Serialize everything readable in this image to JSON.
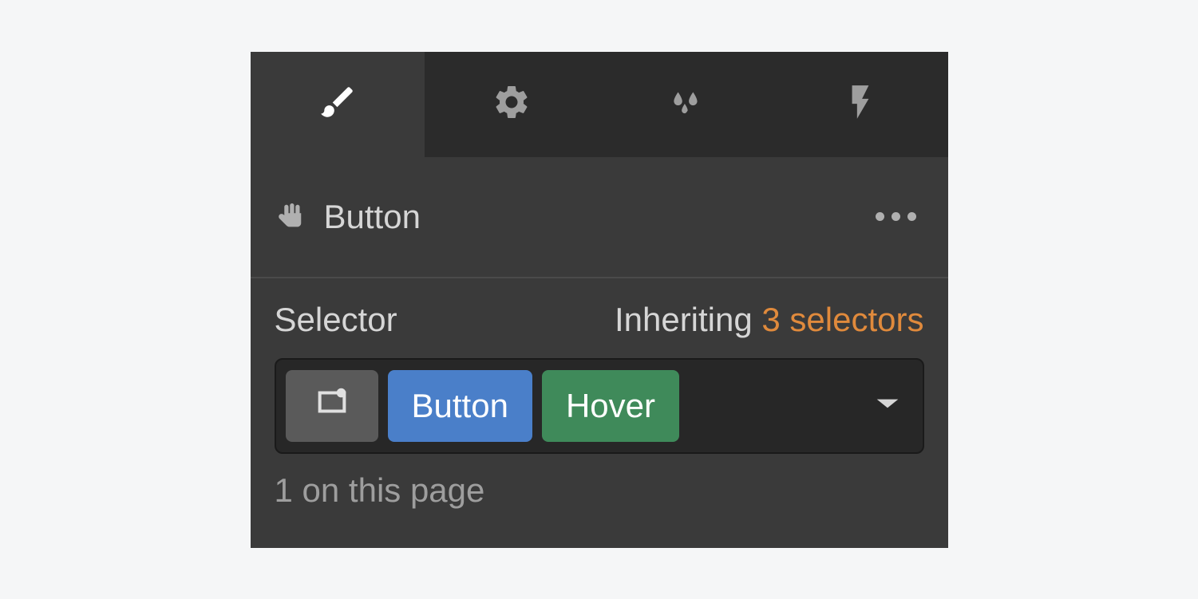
{
  "tabs": {
    "style": "style-icon",
    "settings": "settings-icon",
    "effects": "effects-icon",
    "interactions": "interactions-icon"
  },
  "element": {
    "name": "Button"
  },
  "selector": {
    "label": "Selector",
    "inheriting_label": "Inheriting",
    "inheriting_count": "3 selectors",
    "tags": {
      "button": "Button",
      "hover": "Hover"
    },
    "page_count": "1 on this page"
  }
}
